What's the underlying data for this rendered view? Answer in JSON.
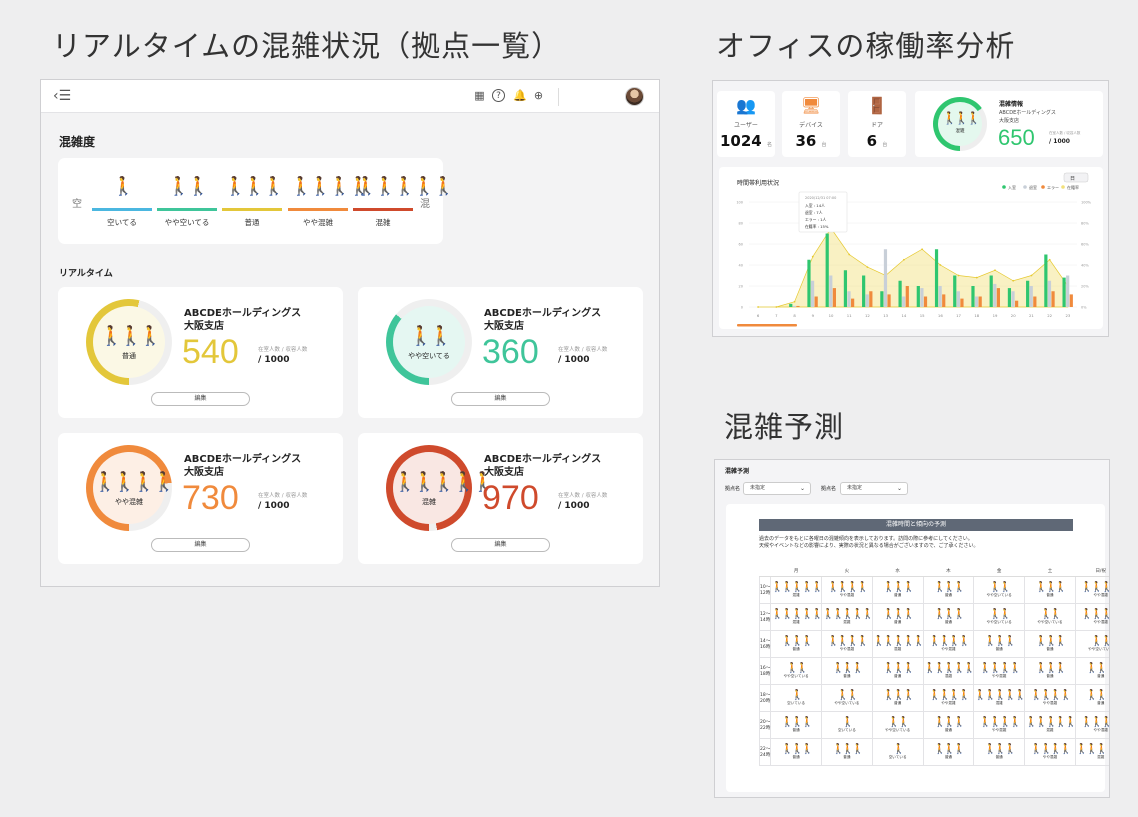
{
  "titles": {
    "left": "リアルタイムの混雑状況（拠点一覧）",
    "right_top": "オフィスの稼働率分析",
    "right_bottom": "混雑予測"
  },
  "colors": {
    "empty": "#4bb7e0",
    "slightly_empty": "#3fc59a",
    "normal": "#e3c73a",
    "slightly_crowded": "#f08a3c",
    "crowded": "#cf4a2c"
  },
  "topbar": {
    "back_menu_icon": "back-menu-icon",
    "icons": [
      "qr-code-icon",
      "help-icon",
      "bell-icon",
      "globe-icon"
    ],
    "avatar": "user-avatar"
  },
  "congestion_legend": {
    "title": "混雑度",
    "left_label": "空",
    "right_label": "混",
    "levels": [
      {
        "label": "空いてる",
        "count": 1,
        "color": "#4bb7e0"
      },
      {
        "label": "やや空いてる",
        "count": 2,
        "color": "#3fc59a"
      },
      {
        "label": "普通",
        "count": 3,
        "color": "#e3c73a"
      },
      {
        "label": "やや混雑",
        "count": 4,
        "color": "#f08a3c"
      },
      {
        "label": "混雑",
        "count": 5,
        "color": "#cf4a2c"
      }
    ]
  },
  "realtime": {
    "title": "リアルタイム",
    "cards": [
      {
        "company": "ABCDEホールディングス",
        "branch": "大阪支店",
        "status": "普通",
        "value": "540",
        "max": "/ 1000",
        "caption": "在室人数 / 収容人数",
        "edit": "編集",
        "color": "#e3c73a",
        "fig": 3,
        "ratio": 0.54
      },
      {
        "company": "ABCDEホールディングス",
        "branch": "大阪支店",
        "status": "やや空いてる",
        "value": "360",
        "max": "/ 1000",
        "caption": "在室人数 / 収容人数",
        "edit": "編集",
        "color": "#3fc59a",
        "fig": 2,
        "ratio": 0.36
      },
      {
        "company": "ABCDEホールディングス",
        "branch": "大阪支店",
        "status": "やや混雑",
        "value": "730",
        "max": "/ 1000",
        "caption": "在室人数 / 収容人数",
        "edit": "編集",
        "color": "#f08a3c",
        "fig": 4,
        "ratio": 0.73
      },
      {
        "company": "ABCDEホールディングス",
        "branch": "大阪支店",
        "status": "混雑",
        "value": "970",
        "max": "/ 1000",
        "caption": "在室人数 / 収容人数",
        "edit": "編集",
        "color": "#cf4a2c",
        "fig": 5,
        "ratio": 0.97
      }
    ]
  },
  "analytics": {
    "kpis": [
      {
        "label": "ユーザー",
        "value": "1024",
        "unit": "名",
        "icon": "users-icon"
      },
      {
        "label": "デバイス",
        "value": "36",
        "unit": "台",
        "icon": "devices-icon"
      },
      {
        "label": "ドア",
        "value": "6",
        "unit": "台",
        "icon": "door-icon"
      }
    ],
    "congestion": {
      "title": "混雑情報",
      "sub1": "ABCDEホールディングス",
      "sub2": "大阪支店",
      "status": "混雑",
      "value": "650",
      "caption": "在室人数 / 収容人数",
      "max": "/ 1000",
      "ratio": 0.65
    },
    "chart_data": {
      "type": "bar",
      "title": "時間帯利用状況",
      "date_label": "2020/12/31 07:00",
      "tooltip": [
        "入室 : 14人",
        "退室 : 7人",
        "エラー : 1人",
        "在籍率 : 15%"
      ],
      "legend": [
        "入室",
        "退室",
        "エラー",
        "在籍率"
      ],
      "categories": [
        "6",
        "7",
        "8",
        "9",
        "10",
        "11",
        "12",
        "13",
        "14",
        "15",
        "16",
        "17",
        "18",
        "19",
        "20",
        "21",
        "22",
        "23"
      ],
      "series": [
        {
          "name": "入室",
          "color": "#2fc66f",
          "values": [
            0,
            0,
            3,
            45,
            70,
            35,
            30,
            15,
            25,
            20,
            55,
            30,
            20,
            30,
            18,
            25,
            50,
            28
          ]
        },
        {
          "name": "退室",
          "color": "#c8cfd8",
          "values": [
            0,
            0,
            1,
            25,
            30,
            15,
            12,
            55,
            10,
            18,
            20,
            15,
            10,
            22,
            15,
            20,
            25,
            30
          ]
        },
        {
          "name": "エラー",
          "color": "#f08a3c",
          "values": [
            0,
            0,
            1,
            10,
            18,
            8,
            15,
            12,
            20,
            10,
            12,
            8,
            10,
            18,
            6,
            10,
            15,
            12
          ]
        }
      ],
      "area": {
        "name": "在籍率",
        "color": "#f2e07a",
        "values": [
          0,
          0,
          5,
          48,
          75,
          50,
          38,
          30,
          45,
          55,
          40,
          30,
          28,
          35,
          25,
          30,
          45,
          20
        ]
      },
      "ylim": [
        0,
        100
      ],
      "y_ticks_left": [
        "100",
        "80",
        "60",
        "40",
        "20",
        "0"
      ],
      "y_ticks_right": [
        "100%",
        "80%",
        "60%",
        "40%",
        "20%",
        "0%"
      ],
      "period_selector": "日"
    }
  },
  "forecast": {
    "title": "混雑予測",
    "filter1_label": "拠点名",
    "filter1_value": "未指定",
    "filter2_label": "拠点名",
    "filter2_value": "未指定",
    "table_title": "混雑時間と傾向の予測",
    "description": "過去のデータをもとに各曜日の混雑傾向を表示しております。訪問の際に参考にしてください。\n天候やイベントなどの影響により、実際の状況と異なる場合がございますので、ご了承ください。",
    "days": [
      "月",
      "火",
      "水",
      "木",
      "金",
      "土",
      "日/祝"
    ],
    "time_slots": [
      "10〜12時",
      "12〜14時",
      "14〜16時",
      "16〜18時",
      "18〜20時",
      "20〜22時",
      "22〜24時"
    ],
    "grid": [
      [
        4,
        3,
        2,
        2,
        1,
        2,
        3
      ],
      [
        4,
        4,
        2,
        2,
        1,
        1,
        3
      ],
      [
        2,
        3,
        4,
        3,
        2,
        2,
        1
      ],
      [
        1,
        2,
        2,
        4,
        3,
        2,
        2
      ],
      [
        0,
        1,
        2,
        3,
        4,
        3,
        2
      ],
      [
        2,
        0,
        1,
        2,
        3,
        4,
        3
      ],
      [
        2,
        2,
        0,
        2,
        2,
        3,
        4
      ]
    ],
    "level_labels": [
      "空いている",
      "やや空いている",
      "普通",
      "やや混雑",
      "混雑"
    ]
  }
}
